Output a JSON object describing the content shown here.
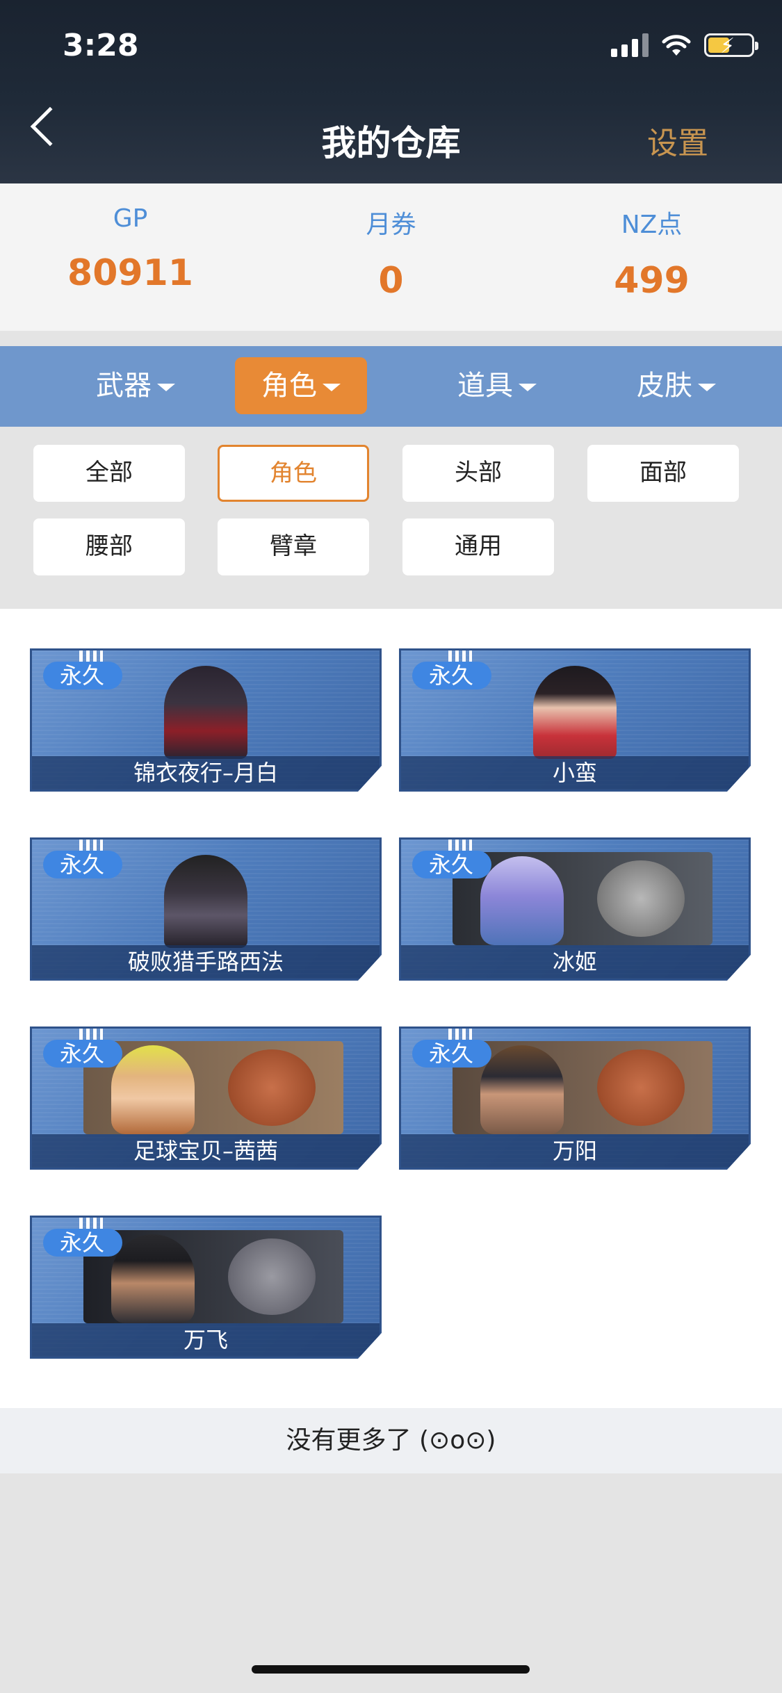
{
  "status_bar": {
    "time": "3:28"
  },
  "header": {
    "title": "我的仓库",
    "settings": "设置"
  },
  "currency": [
    {
      "label": "GP",
      "value": "80911"
    },
    {
      "label": "月券",
      "value": "0"
    },
    {
      "label": "NZ点",
      "value": "499"
    }
  ],
  "main_tabs": [
    {
      "label": "武器"
    },
    {
      "label": "角色"
    },
    {
      "label": "道具"
    },
    {
      "label": "皮肤"
    }
  ],
  "active_main_tab": "角色",
  "sub_filters": [
    {
      "label": "全部"
    },
    {
      "label": "角色"
    },
    {
      "label": "头部"
    },
    {
      "label": "面部"
    },
    {
      "label": "腰部"
    },
    {
      "label": "臂章"
    },
    {
      "label": "通用"
    }
  ],
  "active_sub_filter": "角色",
  "items": [
    {
      "badge": "永久",
      "name": "锦衣夜行–月白"
    },
    {
      "badge": "永久",
      "name": "小蛮"
    },
    {
      "badge": "永久",
      "name": "破败猎手路西法"
    },
    {
      "badge": "永久",
      "name": "冰姬"
    },
    {
      "badge": "永久",
      "name": "足球宝贝–茜茜"
    },
    {
      "badge": "永久",
      "name": "万阳"
    },
    {
      "badge": "永久",
      "name": "万飞"
    }
  ],
  "footer": {
    "no_more": "没有更多了 (⊙o⊙)"
  },
  "colors": {
    "accent": "#e88a36",
    "tab_bar": "#6f97cc",
    "currency_value": "#e2772a",
    "currency_label": "#4e8ed7",
    "settings": "#c89550"
  }
}
